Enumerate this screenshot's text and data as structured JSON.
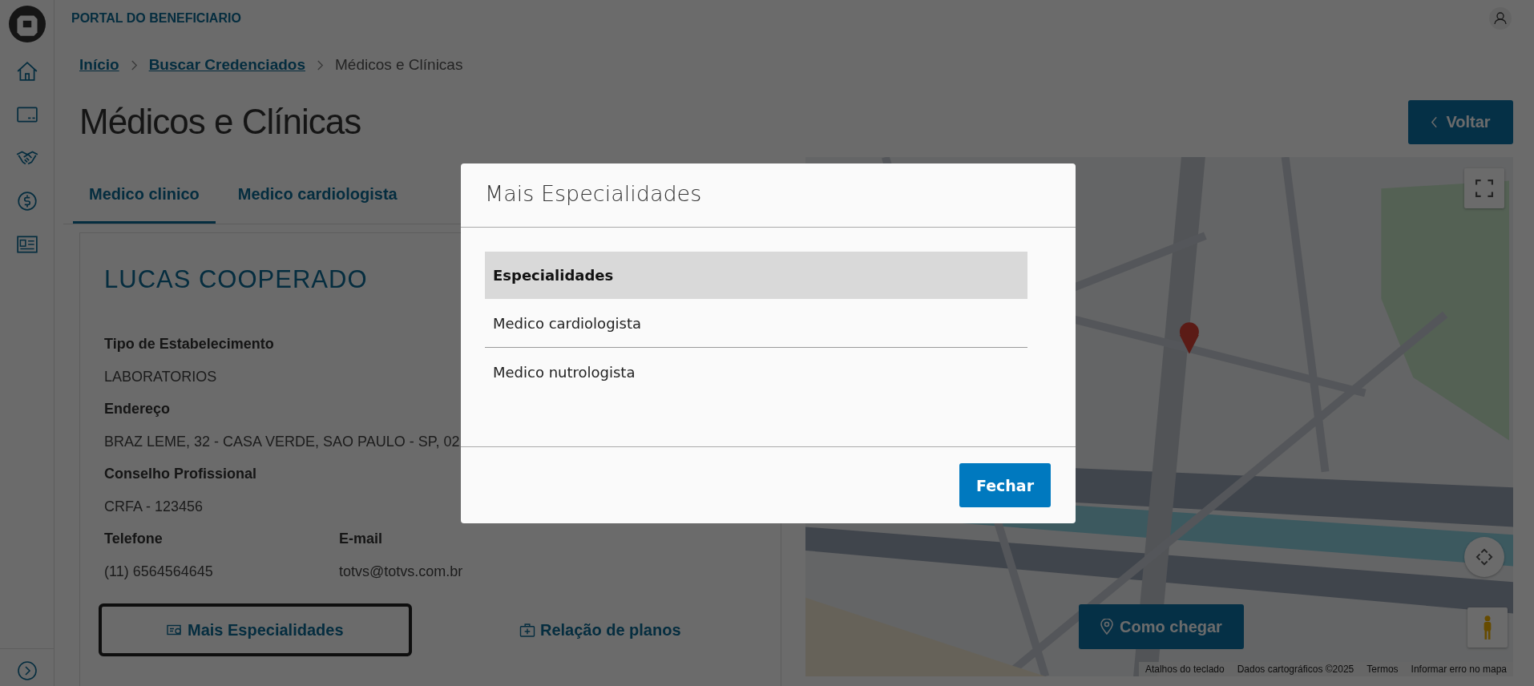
{
  "header": {
    "title": "PORTAL DO BENEFICIARIO"
  },
  "breadcrumb": [
    {
      "label": "Início",
      "link": true
    },
    {
      "label": "Buscar Credenciados",
      "link": true
    },
    {
      "label": "Médicos e Clínicas",
      "link": false
    }
  ],
  "page_title": "Médicos e Clínicas",
  "back_button": {
    "label": "Voltar"
  },
  "tabs": [
    {
      "label": "Medico clinico",
      "selected": true
    },
    {
      "label": "Medico cardiologista",
      "selected": false
    }
  ],
  "provider": {
    "name": "LUCAS COOPERADO",
    "fields": [
      {
        "label": "Tipo de Estabelecimento",
        "value": "LABORATORIOS"
      },
      {
        "label": "Endereço",
        "value": "BRAZ LEME, 32 - CASA VERDE, SAO PAULO - SP, 02"
      },
      {
        "label": "Conselho Profissional",
        "value": "CRFA - 123456"
      }
    ],
    "contacts": [
      {
        "label": "Telefone",
        "value": "(11) 6564564645"
      },
      {
        "label": "E-mail",
        "value": "totvs@totvs.com.br"
      }
    ],
    "buttons": [
      {
        "label": "Mais Especialidades",
        "kind": "specialties",
        "focused": true
      },
      {
        "label": "Relação de planos",
        "kind": "plans",
        "focused": false
      }
    ]
  },
  "map": {
    "kind": "picture",
    "directions_button": "Como chegar",
    "footer": [
      "Atalhos do teclado",
      "Dados cartográficos ©2025",
      "Termos",
      "Informar erro no mapa"
    ]
  },
  "modal": {
    "title": "Mais Especialidades",
    "table": {
      "columns": [
        "Especialidades"
      ],
      "rows": [
        "Medico cardiologista",
        "Medico nutrologista"
      ]
    },
    "buttons": [
      "Fechar"
    ]
  }
}
